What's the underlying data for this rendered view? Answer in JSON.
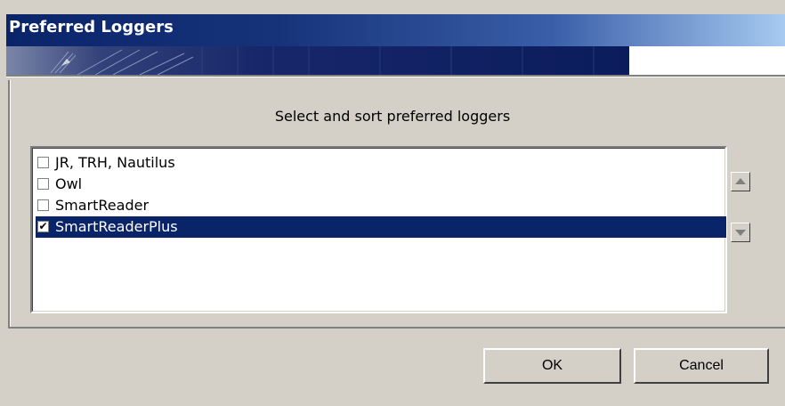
{
  "window": {
    "title": "Preferred Loggers"
  },
  "dialog": {
    "instruction": "Select and sort preferred loggers",
    "loggers": [
      {
        "label": "JR, TRH, Nautilus",
        "checked": false,
        "selected": false
      },
      {
        "label": "Owl",
        "checked": false,
        "selected": false
      },
      {
        "label": "SmartReader",
        "checked": false,
        "selected": false
      },
      {
        "label": "SmartReaderPlus",
        "checked": true,
        "selected": true
      }
    ],
    "check_mark": "✔",
    "move_up_icon": "triangle-up-icon",
    "move_down_icon": "triangle-down-icon"
  },
  "buttons": {
    "ok": "OK",
    "cancel": "Cancel"
  },
  "colors": {
    "title_bar": "#0a246a",
    "selection": "#0a246a",
    "face": "#d4d0c8"
  }
}
